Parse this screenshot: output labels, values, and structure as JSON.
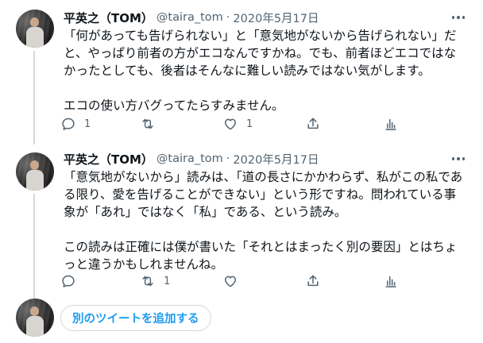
{
  "tweets": [
    {
      "author_name": "平英之（TOM）",
      "handle": "@taira_tom",
      "separator": "·",
      "date": "2020年5月17日",
      "text": "「何があっても告げられない」と「意気地がないから告げられない」だと、やっぱり前者の方がエコなんですかね。でも、前者ほどエコではなかったとしても、後者はそんなに難しい読みではない気がします。\n\nエコの使い方バグってたらすみません。",
      "reply_count": "1",
      "retweet_count": "",
      "like_count": "1"
    },
    {
      "author_name": "平英之（TOM）",
      "handle": "@taira_tom",
      "separator": "·",
      "date": "2020年5月17日",
      "text": "「意気地がないから」読みは、「道の長さにかかわらず、私がこの私である限り、愛を告げることができない」という形ですね。問われている事象が「あれ」ではなく「私」である、という読み。\n\nこの読みは正確には僕が書いた「それとはまったく別の要因」とはちょっと違うかもしれませんね。",
      "reply_count": "",
      "retweet_count": "1",
      "like_count": ""
    }
  ],
  "add_tweet_button": "別のツイートを追加する",
  "icons": {
    "reply": "reply-icon",
    "retweet": "retweet-icon",
    "like": "heart-icon",
    "share": "share-icon",
    "analytics": "analytics-icon",
    "more": "more-icon"
  },
  "colors": {
    "text": "#0f1419",
    "secondary": "#536471",
    "accent": "#1d9bf0",
    "border": "#cfd9de"
  }
}
